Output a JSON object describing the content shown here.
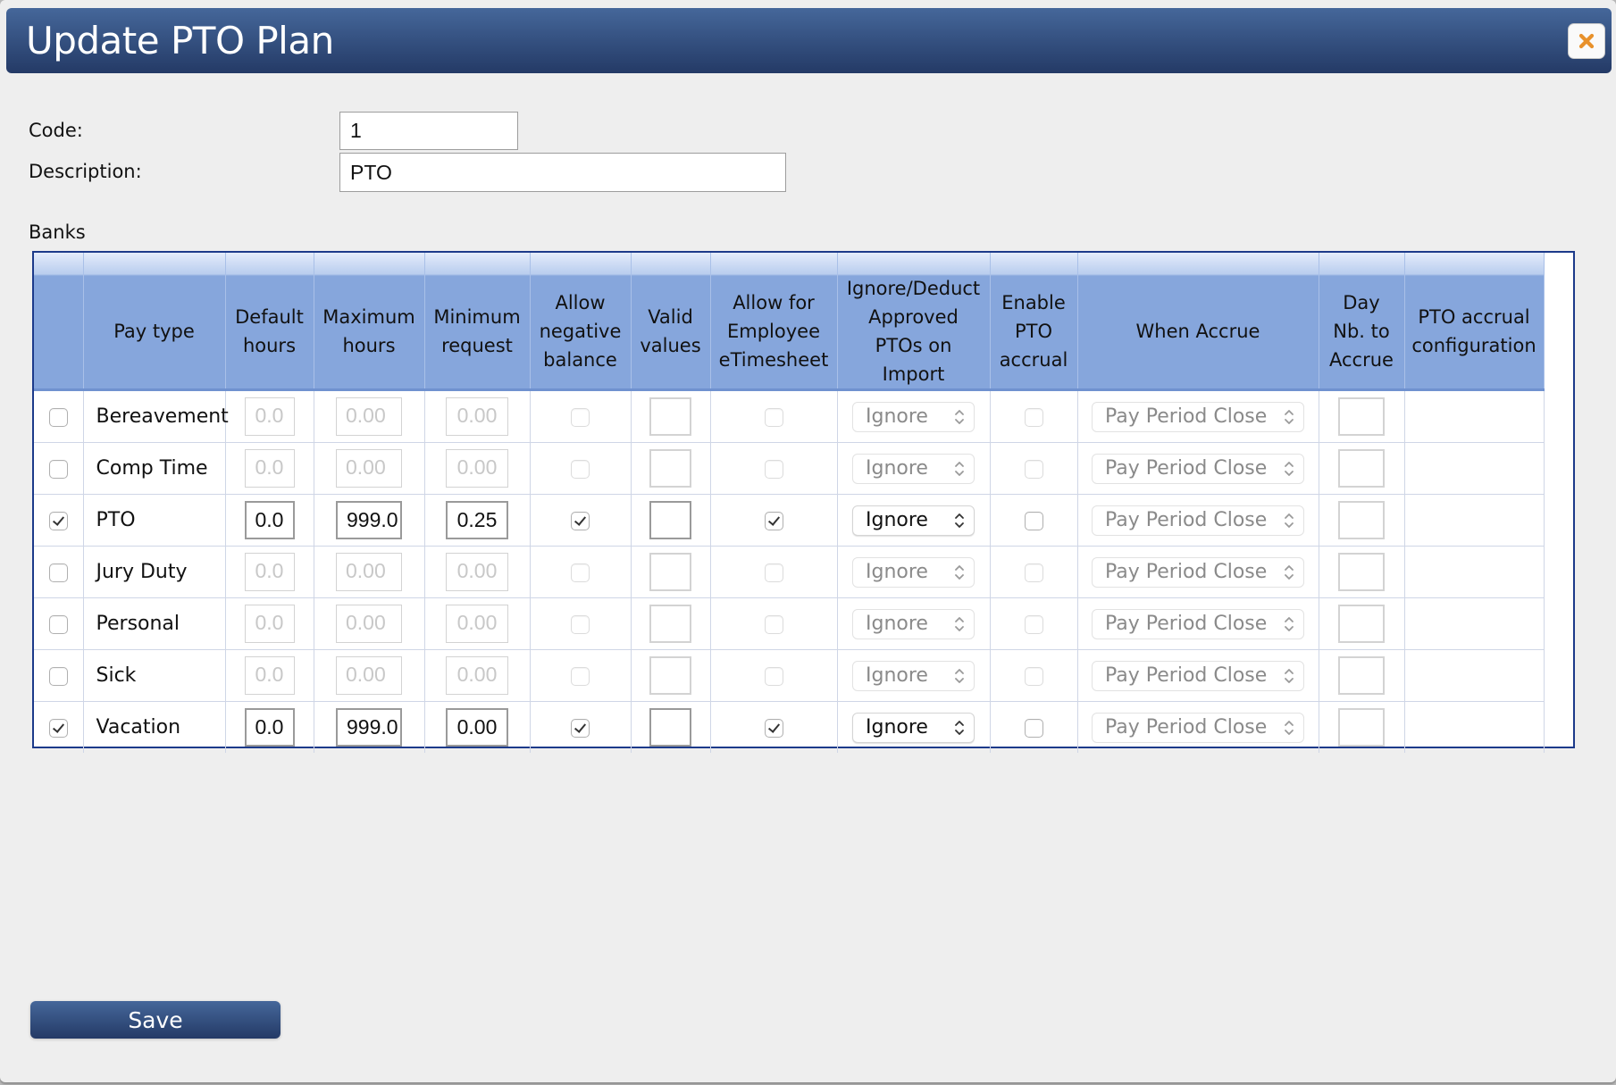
{
  "dialog": {
    "title": "Update PTO Plan",
    "close_icon": "close-x-icon",
    "close_icon_color": "#e8912b",
    "header_color": "#34507f"
  },
  "form": {
    "code_label": "Code:",
    "code_value": "1",
    "description_label": "Description:",
    "description_value": "PTO"
  },
  "banks": {
    "label": "Banks",
    "columns": [
      "",
      "Pay type",
      "Default hours",
      "Maximum hours",
      "Minimum request",
      "Allow negative balance",
      "Valid values",
      "Allow for Employee eTimesheet",
      "Ignore/Deduct Approved PTOs on Import",
      "Enable PTO accrual",
      "When Accrue",
      "Day Nb. to Accrue",
      "PTO accrual configuration"
    ],
    "header_lines": [
      [],
      [
        "Pay type"
      ],
      [
        "Default",
        "hours"
      ],
      [
        "Maximum",
        "hours"
      ],
      [
        "Minimum",
        "request"
      ],
      [
        "Allow",
        "negative",
        "balance"
      ],
      [
        "Valid",
        "values"
      ],
      [
        "Allow for",
        "Employee",
        "eTimesheet"
      ],
      [
        "Ignore/Deduct",
        "Approved",
        "PTOs on",
        "Import"
      ],
      [
        "Enable",
        "PTO",
        "accrual"
      ],
      [
        "When Accrue"
      ],
      [
        "Day",
        "Nb. to",
        "Accrue"
      ],
      [
        "PTO accrual",
        "configuration"
      ]
    ],
    "rows": [
      {
        "selected": false,
        "pay_type": "Bereavement",
        "default_hours": "0.0",
        "maximum_hours": "0.00",
        "minimum_request": "0.00",
        "allow_negative_balance": false,
        "valid_values": "",
        "allow_etimesheet": false,
        "ignore_deduct": "Ignore",
        "enable_accrual": false,
        "when_accrue": "Pay Period Close",
        "day_nb": "",
        "accrual_config": ""
      },
      {
        "selected": false,
        "pay_type": "Comp Time",
        "default_hours": "0.0",
        "maximum_hours": "0.00",
        "minimum_request": "0.00",
        "allow_negative_balance": false,
        "valid_values": "",
        "allow_etimesheet": false,
        "ignore_deduct": "Ignore",
        "enable_accrual": false,
        "when_accrue": "Pay Period Close",
        "day_nb": "",
        "accrual_config": ""
      },
      {
        "selected": true,
        "pay_type": "PTO",
        "default_hours": "0.0",
        "maximum_hours": "999.0",
        "minimum_request": "0.25",
        "allow_negative_balance": true,
        "valid_values": "",
        "allow_etimesheet": true,
        "ignore_deduct": "Ignore",
        "enable_accrual": false,
        "when_accrue": "Pay Period Close",
        "day_nb": "",
        "accrual_config": ""
      },
      {
        "selected": false,
        "pay_type": "Jury Duty",
        "default_hours": "0.0",
        "maximum_hours": "0.00",
        "minimum_request": "0.00",
        "allow_negative_balance": false,
        "valid_values": "",
        "allow_etimesheet": false,
        "ignore_deduct": "Ignore",
        "enable_accrual": false,
        "when_accrue": "Pay Period Close",
        "day_nb": "",
        "accrual_config": ""
      },
      {
        "selected": false,
        "pay_type": "Personal",
        "default_hours": "0.0",
        "maximum_hours": "0.00",
        "minimum_request": "0.00",
        "allow_negative_balance": false,
        "valid_values": "",
        "allow_etimesheet": false,
        "ignore_deduct": "Ignore",
        "enable_accrual": false,
        "when_accrue": "Pay Period Close",
        "day_nb": "",
        "accrual_config": ""
      },
      {
        "selected": false,
        "pay_type": "Sick",
        "default_hours": "0.0",
        "maximum_hours": "0.00",
        "minimum_request": "0.00",
        "allow_negative_balance": false,
        "valid_values": "",
        "allow_etimesheet": false,
        "ignore_deduct": "Ignore",
        "enable_accrual": false,
        "when_accrue": "Pay Period Close",
        "day_nb": "",
        "accrual_config": ""
      },
      {
        "selected": true,
        "pay_type": "Vacation",
        "default_hours": "0.0",
        "maximum_hours": "999.0",
        "minimum_request": "0.00",
        "allow_negative_balance": true,
        "valid_values": "",
        "allow_etimesheet": true,
        "ignore_deduct": "Ignore",
        "enable_accrual": false,
        "when_accrue": "Pay Period Close",
        "day_nb": "",
        "accrual_config": ""
      }
    ]
  },
  "footer": {
    "save_label": "Save"
  }
}
